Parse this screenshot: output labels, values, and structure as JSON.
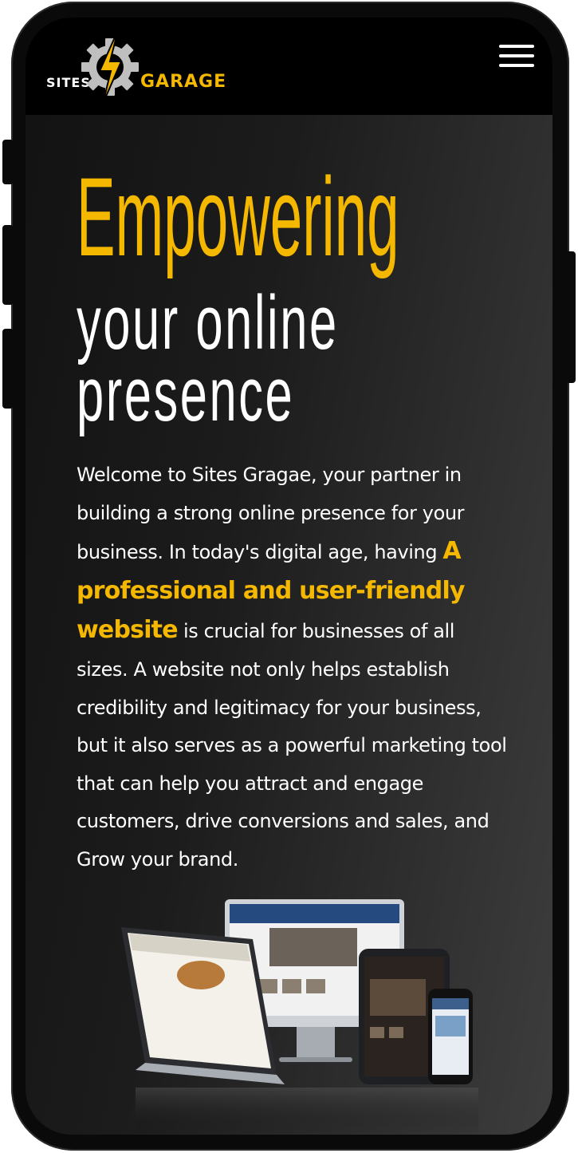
{
  "logo": {
    "left_text": "SITES",
    "right_text": "GARAGE",
    "accent_color": "#f5b800"
  },
  "menu": {
    "icon": "hamburger-menu-icon"
  },
  "hero": {
    "headline": "Empowering",
    "subheadline_line1": "your online",
    "subheadline_line2": "presence",
    "paragraph_before": "Welcome to Sites Gragae, your partner in building a strong online presence for your business. In today's digital age, having ",
    "paragraph_highlight": "A professional and user-friendly website",
    "paragraph_after": " is crucial for businesses of all sizes. A website not only helps establish credibility and legitimacy for your business, but it also serves as a powerful marketing tool that can help you attract and engage customers, drive conversions and sales, and Grow your brand."
  },
  "image": {
    "icon": "responsive-devices-illustration"
  },
  "colors": {
    "accent": "#f5b800",
    "background": "#1c1c1c",
    "text": "#ffffff"
  }
}
